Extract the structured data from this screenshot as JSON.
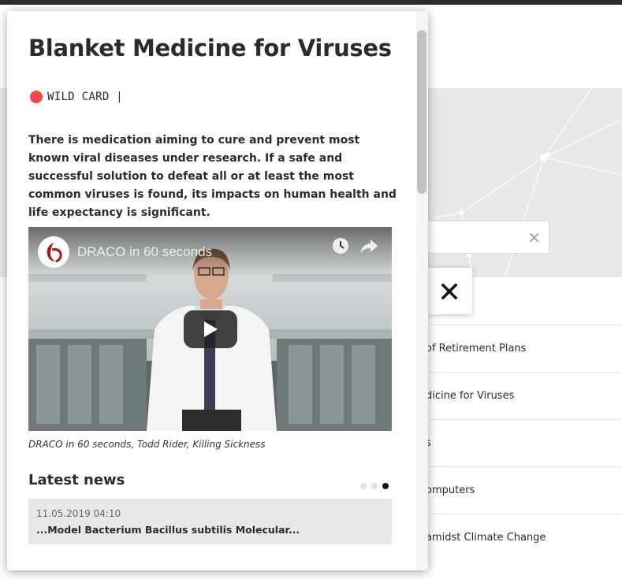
{
  "modal": {
    "title": "Blanket Medicine for Viruses",
    "tag": {
      "label": "WILD CARD |",
      "color": "#f04848"
    },
    "description": "There is medication aiming to cure and prevent most known viral diseases under research. If a safe and successful solution to defeat all or at least the most common viruses is found, its impacts on human health and life expectancy is significant.",
    "video": {
      "title": "DRACO in 60 seconds",
      "caption": "DRACO in 60 seconds, Todd Rider, Killing Sickness",
      "icons": [
        "channel-logo",
        "watch-later-icon",
        "share-icon",
        "play-icon"
      ]
    },
    "latest_news": {
      "heading": "Latest news",
      "carousel_dots": 3,
      "active_dot": 3,
      "items": [
        {
          "date": "11.05.2019 04:10",
          "title": "...Model Bacterium Bacillus subtilis Molecular..."
        }
      ]
    }
  },
  "background": {
    "search_clear_icon": "×",
    "close_icon": "close-icon",
    "list_items": [
      "",
      "of Retirement Plans",
      "dicine for Viruses",
      "s",
      "omputers",
      "amidst Climate Change"
    ]
  }
}
